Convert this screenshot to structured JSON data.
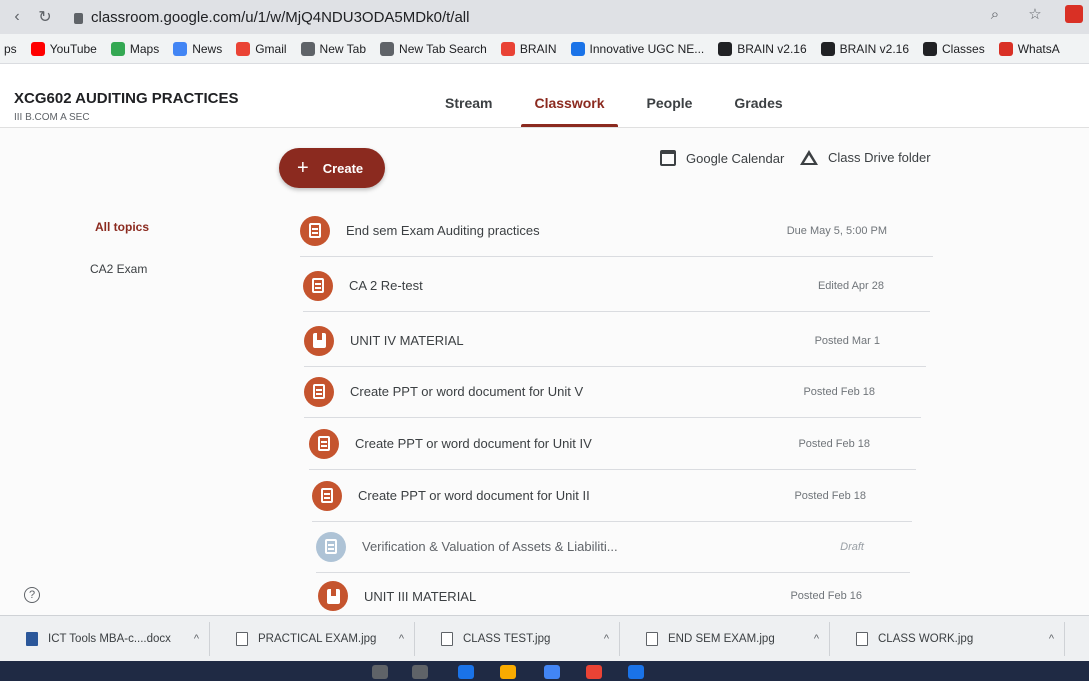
{
  "browser": {
    "url": "classroom.google.com/u/1/w/MjQ4NDU3ODA5MDk0/t/all",
    "bookmarks": [
      {
        "label": "ps",
        "color": ""
      },
      {
        "label": "YouTube",
        "color": "#ff0000"
      },
      {
        "label": "Maps",
        "color": "#34a853"
      },
      {
        "label": "News",
        "color": "#4285f4"
      },
      {
        "label": "Gmail",
        "color": "#ea4335"
      },
      {
        "label": "New Tab",
        "color": "#5f6368"
      },
      {
        "label": "New Tab Search",
        "color": "#5f6368"
      },
      {
        "label": "BRAIN",
        "color": "#e94235"
      },
      {
        "label": "Innovative UGC NE...",
        "color": "#1a73e8"
      },
      {
        "label": "BRAIN v2.16",
        "color": "#202124"
      },
      {
        "label": "BRAIN v2.16",
        "color": "#202124"
      },
      {
        "label": "Classes",
        "color": "#202124"
      },
      {
        "label": "WhatsA",
        "color": "#d93025"
      }
    ]
  },
  "course": {
    "title": "XCG602 AUDITING PRACTICES",
    "section": "III B.COM A SEC"
  },
  "tabs": [
    {
      "label": "Stream",
      "active": false
    },
    {
      "label": "Classwork",
      "active": true
    },
    {
      "label": "People",
      "active": false
    },
    {
      "label": "Grades",
      "active": false
    }
  ],
  "toolbar": {
    "create_label": "Create",
    "calendar_label": "Google Calendar",
    "drive_label": "Class Drive folder"
  },
  "topics": [
    "All topics",
    "CA2 Exam"
  ],
  "items": [
    {
      "title": "End sem Exam Auditing practices",
      "meta": "Due May 5, 5:00 PM",
      "icon": "assignment-icon",
      "draft": false
    },
    {
      "title": "CA 2 Re-test",
      "meta": "Edited Apr 28",
      "icon": "assignment-icon",
      "draft": false
    },
    {
      "title": "UNIT IV MATERIAL",
      "meta": "Posted Mar 1",
      "icon": "material-icon",
      "draft": false
    },
    {
      "title": "Create PPT or word document for Unit V",
      "meta": "Posted Feb 18",
      "icon": "assignment-icon",
      "draft": false
    },
    {
      "title": "Create PPT or word document for Unit IV",
      "meta": "Posted Feb 18",
      "icon": "assignment-icon",
      "draft": false
    },
    {
      "title": "Create PPT or word document for Unit II",
      "meta": "Posted Feb 18",
      "icon": "assignment-icon",
      "draft": false
    },
    {
      "title": "Verification & Valuation of Assets & Liabiliti...",
      "meta": "Draft",
      "icon": "assignment-icon",
      "draft": true
    },
    {
      "title": "UNIT III MATERIAL",
      "meta": "Posted Feb 16",
      "icon": "material-icon",
      "draft": false
    }
  ],
  "downloads": [
    {
      "name": "ICT Tools MBA-c....docx",
      "type": "word"
    },
    {
      "name": "PRACTICAL EXAM.jpg",
      "type": "image"
    },
    {
      "name": "CLASS TEST.jpg",
      "type": "image"
    },
    {
      "name": "END SEM EXAM.jpg",
      "type": "image"
    },
    {
      "name": "CLASS WORK.jpg",
      "type": "image"
    }
  ],
  "colors": {
    "accent": "#8b2a1f",
    "item_icon": "#c5542e",
    "draft_icon": "#aec3d6"
  }
}
